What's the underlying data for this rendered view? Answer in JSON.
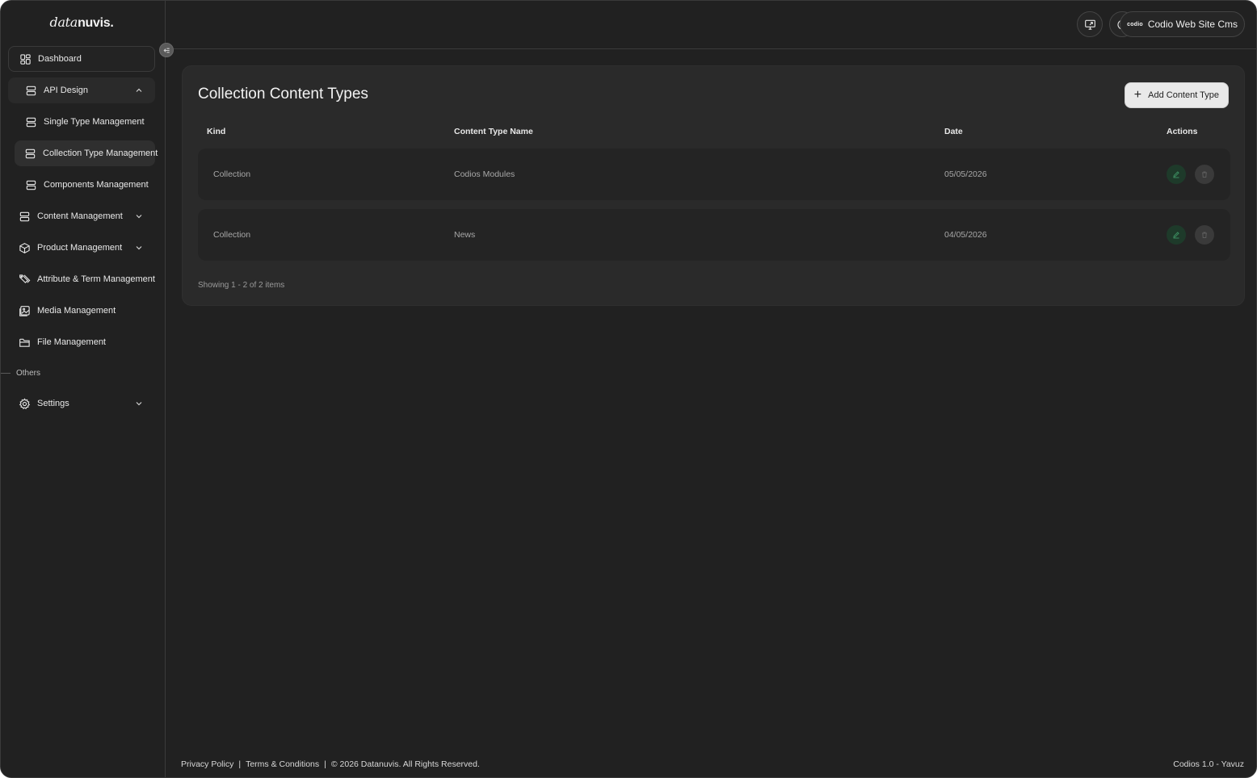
{
  "brand": {
    "logo_part1": "data",
    "logo_part2": "nuvis."
  },
  "sidebar": {
    "items": [
      {
        "label": "Dashboard",
        "icon": "grid-icon"
      },
      {
        "label": "API Design",
        "icon": "stack-icon",
        "expanded": true
      },
      {
        "label": "Single Type Management",
        "icon": "stack-icon"
      },
      {
        "label": "Collection Type Management",
        "icon": "stack-icon",
        "active": true
      },
      {
        "label": "Components Management",
        "icon": "stack-icon"
      },
      {
        "label": "Content Management",
        "icon": "stack-icon"
      },
      {
        "label": "Product Management",
        "icon": "box-icon"
      },
      {
        "label": "Attribute & Term Management",
        "icon": "tag-icon"
      },
      {
        "label": "Media Management",
        "icon": "image-icon"
      },
      {
        "label": "File Management",
        "icon": "folder-icon"
      },
      {
        "label": "Settings",
        "icon": "gear-icon"
      }
    ],
    "section_others": "Others"
  },
  "header": {
    "site_brand": "codio",
    "site_name": "Codio Web Site Cms"
  },
  "main": {
    "title": "Collection Content Types",
    "add_button": "Add Content Type",
    "columns": {
      "kind": "Kind",
      "name": "Content Type Name",
      "date": "Date",
      "actions": "Actions"
    },
    "rows": [
      {
        "kind": "Collection",
        "name": "Codios Modules",
        "date": "05/05/2026"
      },
      {
        "kind": "Collection",
        "name": "News",
        "date": "04/05/2026"
      }
    ],
    "showing": "Showing 1 - 2 of 2 items"
  },
  "footer": {
    "privacy": "Privacy Policy",
    "terms": "Terms & Conditions",
    "copyright": "© 2026 Datanuvis. All Rights Reserved.",
    "version": "Codios 1.0 - Yavuz",
    "separator": "|"
  },
  "colors": {
    "background": "#212121",
    "card": "#2a2a2a",
    "row": "#242424",
    "edit_action": "#1e3a2a",
    "add_button_bg": "#e9e9e9"
  }
}
